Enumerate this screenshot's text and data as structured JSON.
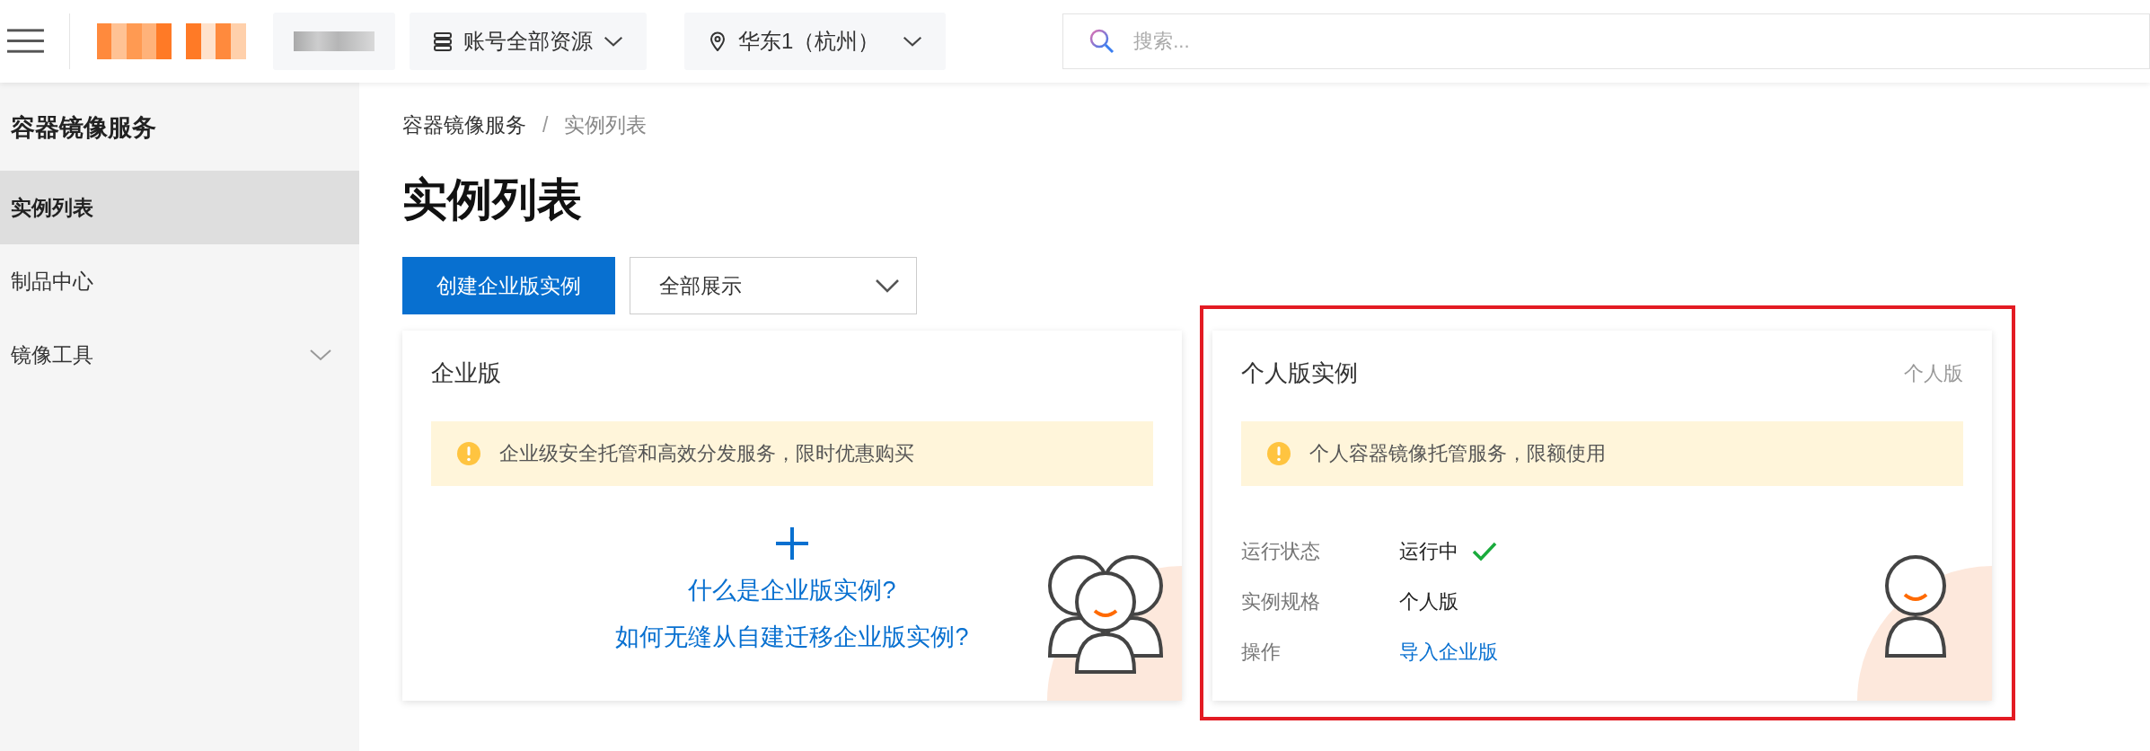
{
  "top_bar": {
    "account_scope": "账号全部资源",
    "region": "华东1（杭州）",
    "search": {
      "placeholder": "搜索..."
    }
  },
  "sidebar": {
    "title": "容器镜像服务",
    "items": [
      {
        "label": "实例列表",
        "selected": true,
        "kind": "link"
      },
      {
        "label": "制品中心",
        "selected": false,
        "kind": "link"
      },
      {
        "label": "镜像工具",
        "selected": false,
        "kind": "group"
      }
    ]
  },
  "breadcrumb": {
    "separator": "/",
    "items": [
      {
        "label": "容器镜像服务",
        "current": false
      },
      {
        "label": "实例列表",
        "current": true
      }
    ]
  },
  "page_title": "实例列表",
  "toolbar": {
    "create_button": "创建企业版实例",
    "filter": {
      "value": "全部展示"
    }
  },
  "cards": [
    {
      "kind": "enterprise",
      "title": "企业版",
      "notice": "企业级安全托管和高效分发服务，限时优惠购买",
      "links": [
        "什么是企业版实例?",
        "如何无缝从自建迁移企业版实例?"
      ]
    },
    {
      "kind": "personal",
      "title": "个人版实例",
      "tag": "个人版",
      "highlighted": true,
      "notice": "个人容器镜像托管服务，限额使用",
      "fields": [
        {
          "label": "运行状态",
          "value": "运行中",
          "kind": "status"
        },
        {
          "label": "实例规格",
          "value": "个人版",
          "kind": "text"
        },
        {
          "label": "操作",
          "value": "导入企业版",
          "kind": "link"
        }
      ]
    }
  ]
}
